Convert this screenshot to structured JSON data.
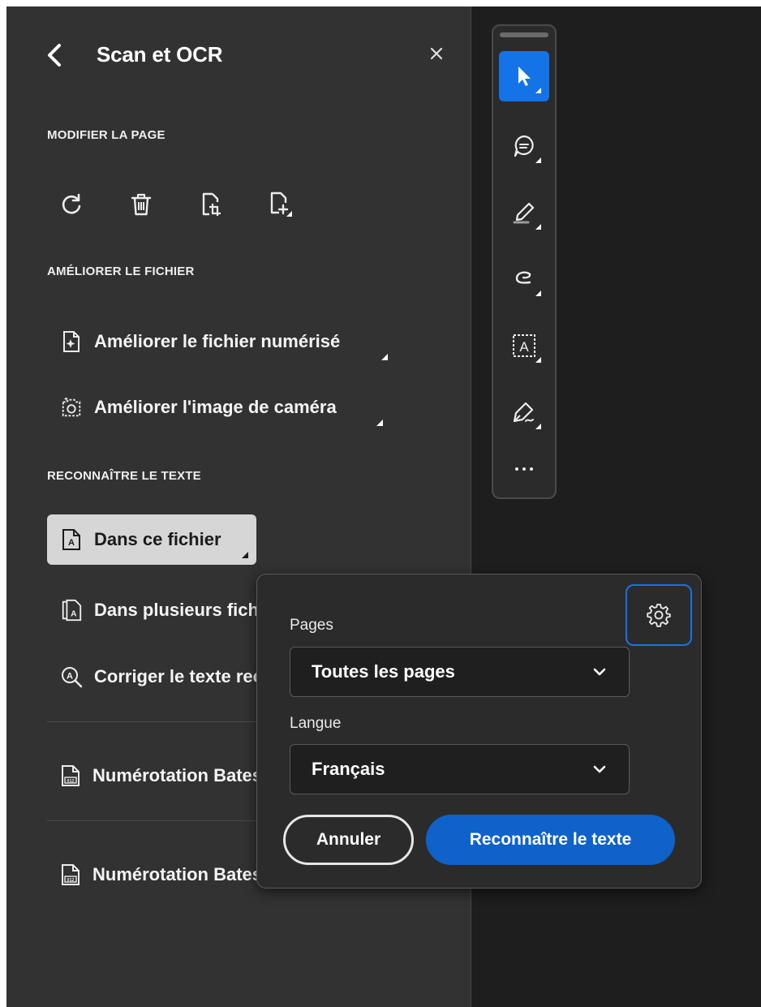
{
  "panel": {
    "title": "Scan et OCR",
    "sections": {
      "modify_page": "MODIFIER LA PAGE",
      "enhance_file": "AMÉLIORER LE FICHIER",
      "recognize_text": "RECONNAÎTRE LE TEXTE"
    },
    "page_tools": [
      "rotate-icon",
      "trash-icon",
      "crop-page-icon",
      "insert-page-icon"
    ],
    "enhance_items": [
      {
        "label": "Améliorer le fichier numérisé",
        "icon": "enhance-scan-icon"
      },
      {
        "label": "Améliorer l'image de caméra",
        "icon": "enhance-camera-icon"
      }
    ],
    "recognize_items": [
      {
        "label": "Dans ce fichier",
        "icon": "ocr-file-icon"
      },
      {
        "label": "Dans plusieurs fichiers",
        "icon": "ocr-multiple-files-icon"
      },
      {
        "label": "Corriger le texte reconnu",
        "icon": "correct-text-icon"
      }
    ],
    "bates_items": [
      {
        "label": "Numérotation Bates",
        "icon": "bates-numbering-icon"
      },
      {
        "label": "Numérotation Bates",
        "icon": "bates-numbering-icon"
      }
    ]
  },
  "toolbar": {
    "tools": [
      "select-arrow-icon",
      "comment-icon",
      "highlight-pen-icon",
      "draw-lasso-icon",
      "text-recognition-icon",
      "sign-icon",
      "more-icon"
    ],
    "active_tool": "select-arrow-icon"
  },
  "popup": {
    "pages_label": "Pages",
    "pages_value": "Toutes les pages",
    "language_label": "Langue",
    "language_value": "Français",
    "cancel_label": "Annuler",
    "confirm_label": "Reconnaître le texte"
  },
  "colors": {
    "accent": "#1473e6",
    "primary_button": "#0f62c9",
    "panel_bg": "#323232",
    "popup_bg": "#2b2b2b",
    "selected_item_bg": "#d6d6d6"
  }
}
